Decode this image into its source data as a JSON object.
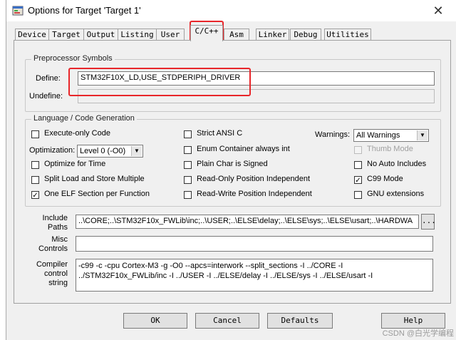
{
  "window": {
    "title": "Options for Target 'Target 1'"
  },
  "tabs": [
    {
      "label": "Device"
    },
    {
      "label": "Target"
    },
    {
      "label": "Output"
    },
    {
      "label": "Listing"
    },
    {
      "label": "User"
    },
    {
      "label": "C/C++"
    },
    {
      "label": "Asm"
    },
    {
      "label": "Linker"
    },
    {
      "label": "Debug"
    },
    {
      "label": "Utilities"
    }
  ],
  "preprocessor": {
    "group_label": "Preprocessor Symbols",
    "define_label": "Define:",
    "define_value": "STM32F10X_LD,USE_STDPERIPH_DRIVER",
    "undefine_label": "Undefine:",
    "undefine_value": ""
  },
  "language": {
    "group_label": "Language / Code Generation",
    "execute_only": {
      "label": "Execute-only Code",
      "checked": false
    },
    "optimization_label": "Optimization:",
    "optimization_value": "Level 0 (-O0)",
    "optimize_time": {
      "label": "Optimize for Time",
      "checked": false
    },
    "split_load": {
      "label": "Split Load and Store Multiple",
      "checked": false
    },
    "one_elf": {
      "label": "One ELF Section per Function",
      "checked": true
    },
    "strict_ansi": {
      "label": "Strict ANSI C",
      "checked": false
    },
    "enum_container": {
      "label": "Enum Container always int",
      "checked": false
    },
    "plain_char": {
      "label": "Plain Char is Signed",
      "checked": false
    },
    "ro_pi": {
      "label": "Read-Only Position Independent",
      "checked": false
    },
    "rw_pi": {
      "label": "Read-Write Position Independent",
      "checked": false
    },
    "warnings_label": "Warnings:",
    "warnings_value": "All Warnings",
    "thumb_mode": {
      "label": "Thumb Mode",
      "checked": false
    },
    "no_auto_includes": {
      "label": "No Auto Includes",
      "checked": false
    },
    "c99_mode": {
      "label": "C99 Mode",
      "checked": true
    },
    "gnu_ext": {
      "label": "GNU extensions",
      "checked": false
    }
  },
  "include": {
    "label_line1": "Include",
    "label_line2": "Paths",
    "value": "..\\CORE;..\\STM32F10x_FWLib\\inc;..\\USER;..\\ELSE\\delay;..\\ELSE\\sys;..\\ELSE\\usart;..\\HARDWA",
    "browse_label": "..."
  },
  "misc": {
    "label_line1": "Misc",
    "label_line2": "Controls",
    "value": ""
  },
  "compiler": {
    "label_line1": "Compiler",
    "label_line2": "control",
    "label_line3": "string",
    "line1": "-c99 -c -cpu Cortex-M3 -g -O0 --apcs=interwork --split_sections -I ../CORE -I",
    "line2": "../STM32F10x_FWLib/inc -I ../USER -I ../ELSE/delay -I ../ELSE/sys -I ../ELSE/usart -I"
  },
  "buttons": {
    "ok": "OK",
    "cancel": "Cancel",
    "defaults": "Defaults",
    "help": "Help"
  },
  "watermark": "CSDN @白光学编程",
  "colors": {
    "highlight": "#e8262a",
    "dialog_bg": "#f0f0f0"
  }
}
